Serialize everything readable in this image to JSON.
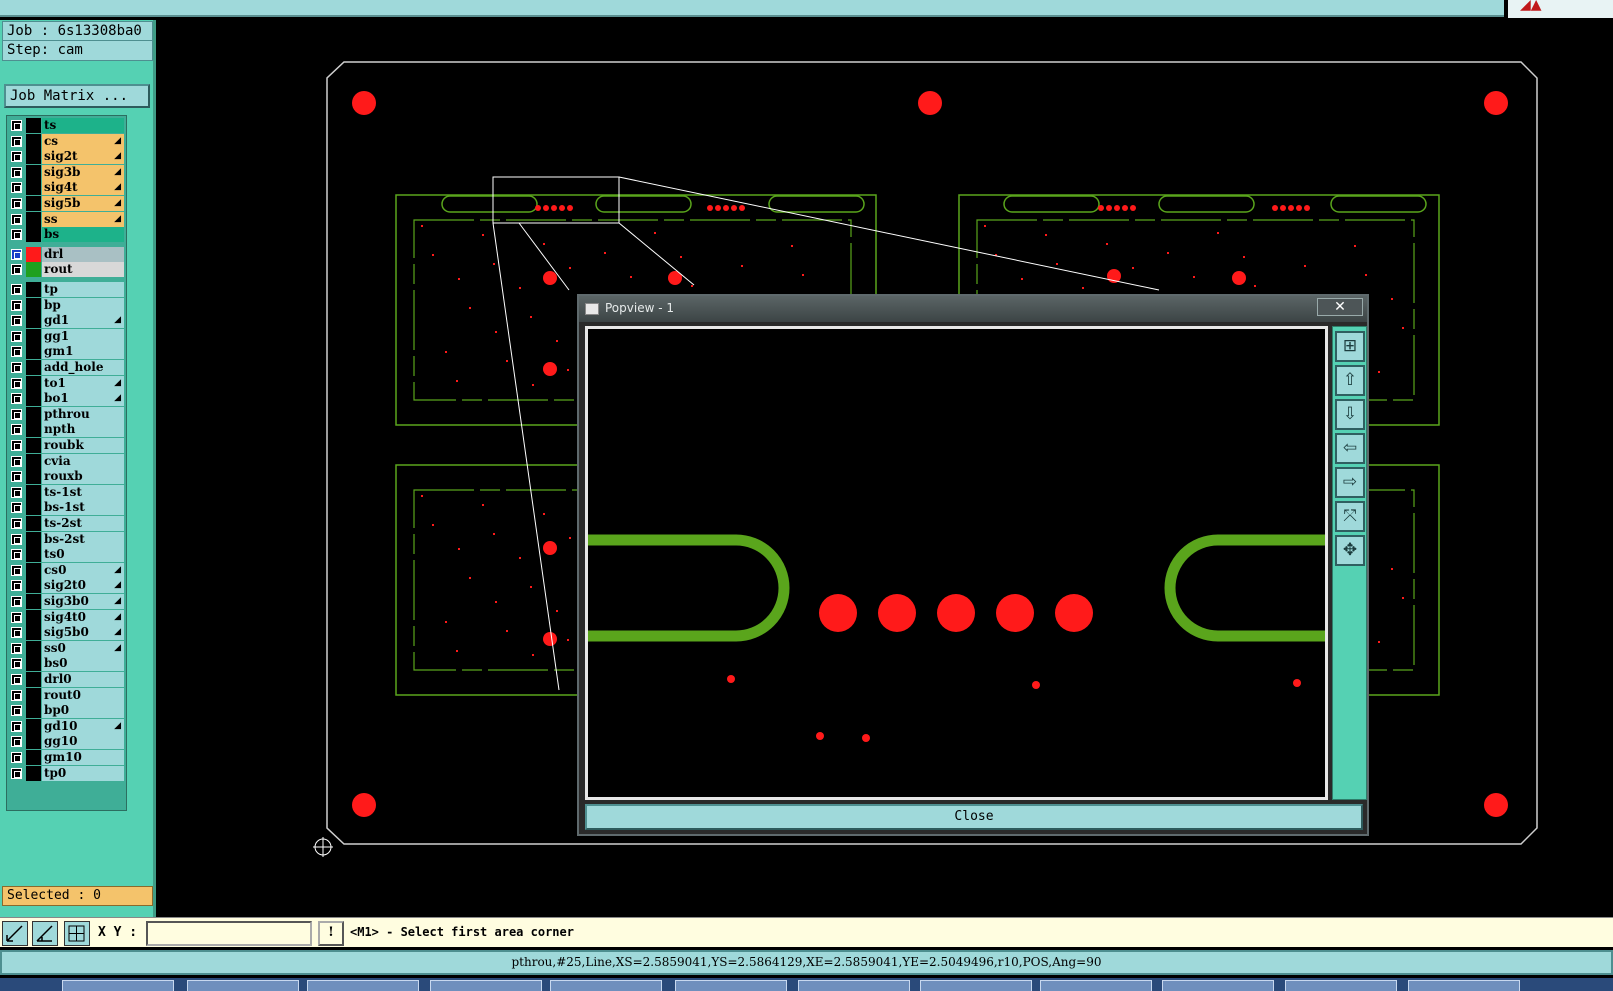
{
  "job_label": "Job : 6s13308ba0",
  "step_label": "Step: cam",
  "job_matrix_button": "Job Matrix ...",
  "colors": {
    "board_active": "#1db28a",
    "signal_layer": "#f4c36b",
    "drill_layer": "#a9c0c4",
    "rout_layer": "#d8d8d8",
    "other_layer": "#9fd9da",
    "copper_green": "#5aa51c",
    "drill_red": "#ff1a1a"
  },
  "layers": [
    {
      "name": "ts",
      "type": "board"
    },
    {
      "name": "cs",
      "type": "signal",
      "flag": true
    },
    {
      "name": "sig2t",
      "type": "signal",
      "flag": true
    },
    {
      "name": "sig3b",
      "type": "signal",
      "flag": true
    },
    {
      "name": "sig4t",
      "type": "signal",
      "flag": true
    },
    {
      "name": "sig5b",
      "type": "signal",
      "flag": true
    },
    {
      "name": "ss",
      "type": "signal",
      "flag": true
    },
    {
      "name": "bs",
      "type": "board"
    },
    {
      "name": "drl",
      "type": "drill",
      "active": "red"
    },
    {
      "name": "rout",
      "type": "rout",
      "active": "green"
    },
    {
      "name": "tp",
      "type": "misc"
    },
    {
      "name": "bp",
      "type": "misc"
    },
    {
      "name": "gd1",
      "type": "misc",
      "flag": true
    },
    {
      "name": "gg1",
      "type": "misc"
    },
    {
      "name": "gm1",
      "type": "misc"
    },
    {
      "name": "add_hole",
      "type": "misc"
    },
    {
      "name": "to1",
      "type": "misc",
      "flag": true
    },
    {
      "name": "bo1",
      "type": "misc",
      "flag": true
    },
    {
      "name": "pthrou",
      "type": "misc"
    },
    {
      "name": "npth",
      "type": "misc"
    },
    {
      "name": "roubk",
      "type": "misc"
    },
    {
      "name": "cvia",
      "type": "misc"
    },
    {
      "name": "rouxb",
      "type": "misc"
    },
    {
      "name": "ts-1st",
      "type": "misc"
    },
    {
      "name": "bs-1st",
      "type": "misc"
    },
    {
      "name": "ts-2st",
      "type": "misc"
    },
    {
      "name": "bs-2st",
      "type": "misc"
    },
    {
      "name": "ts0",
      "type": "misc"
    },
    {
      "name": "cs0",
      "type": "misc",
      "flag": true
    },
    {
      "name": "sig2t0",
      "type": "misc",
      "flag": true
    },
    {
      "name": "sig3b0",
      "type": "misc",
      "flag": true
    },
    {
      "name": "sig4t0",
      "type": "misc",
      "flag": true
    },
    {
      "name": "sig5b0",
      "type": "misc",
      "flag": true
    },
    {
      "name": "ss0",
      "type": "misc",
      "flag": true
    },
    {
      "name": "bs0",
      "type": "misc"
    },
    {
      "name": "drl0",
      "type": "misc"
    },
    {
      "name": "rout0",
      "type": "misc"
    },
    {
      "name": "bp0",
      "type": "misc"
    },
    {
      "name": "gd10",
      "type": "misc",
      "flag": true
    },
    {
      "name": "gg10",
      "type": "misc"
    },
    {
      "name": "gm10",
      "type": "misc"
    },
    {
      "name": "tp0",
      "type": "misc"
    }
  ],
  "selected_label": "Selected : 0",
  "toolbar": {
    "xy_label": "X Y :",
    "xy_value": "",
    "excl_label": "!",
    "prompt": "<M1> - Select first area corner"
  },
  "status_line": "pthrou,#25,Line,XS=2.5859041,YS=2.5864129,XE=2.5859041,YE=2.5049496,r10,POS,Ang=90",
  "popview": {
    "title": "Popview - 1",
    "close_x": "✕",
    "close_button": "Close",
    "side_buttons": [
      "zoom-area-icon",
      "pan-up-icon",
      "pan-down-icon",
      "pan-left-icon",
      "pan-right-icon",
      "zoom-in-icon",
      "zoom-out-icon"
    ]
  }
}
